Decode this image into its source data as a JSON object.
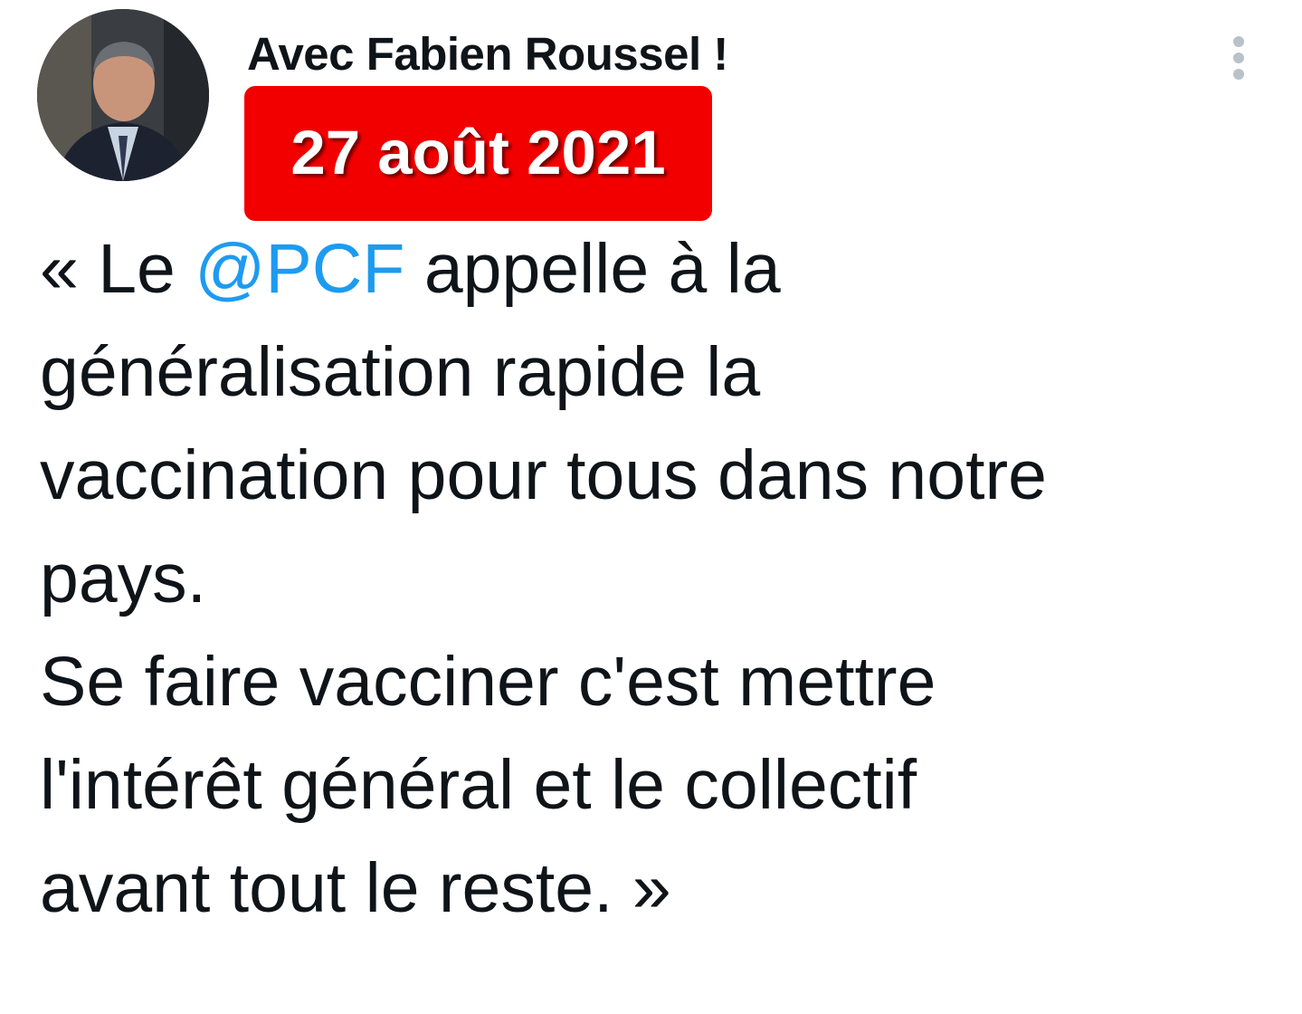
{
  "tweet": {
    "author_name": "Avec Fabien Roussel !",
    "date_badge": "27 août 2021",
    "more_icon": "vertical-ellipsis-icon",
    "colors": {
      "badge_background": "#f20000",
      "badge_text": "#ffffff",
      "mention": "#1d9bf0",
      "text": "#0f1419",
      "more_icon": "#b9c2c8"
    },
    "text": {
      "line1_before": "« Le ",
      "mention": "@PCF",
      "line1_after": " appelle à la",
      "line2": "généralisation rapide la",
      "line3": "vaccination pour tous dans notre",
      "line4": "pays.",
      "line5": "Se faire vacciner c'est mettre",
      "line6": "l'intérêt général et le collectif",
      "line7": "avant tout le reste. »"
    }
  }
}
